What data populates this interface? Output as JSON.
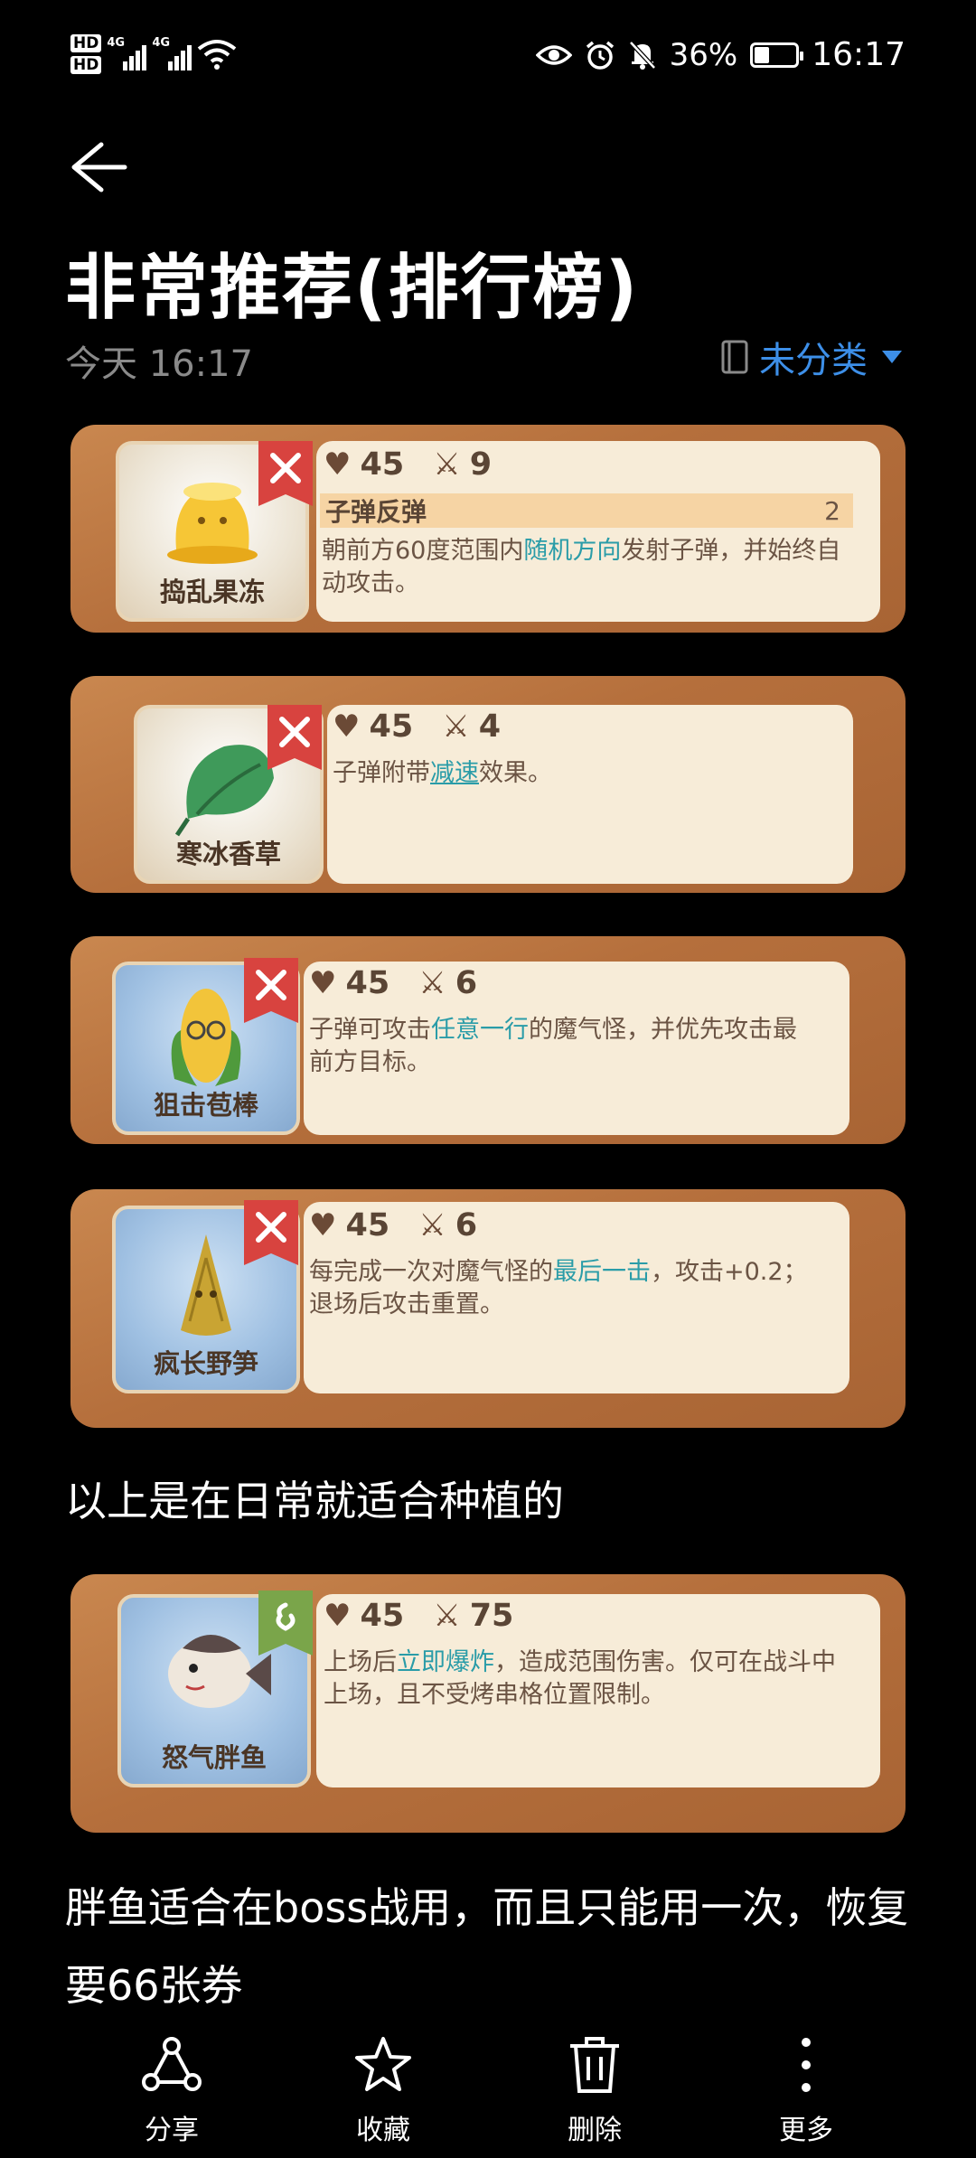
{
  "status": {
    "hd1": "HD",
    "hd2": "HD",
    "sim1": "4G",
    "sim2": "4G",
    "battery_pct": "36%",
    "battery_level": 0.36,
    "time": "16:17"
  },
  "note": {
    "title": "非常推荐(排行榜)",
    "date": "今天 16:17",
    "category": "未分类"
  },
  "cards": [
    {
      "name": "捣乱果冻",
      "hp": "45",
      "atk": "9",
      "badge": "attack",
      "tag": "子弹反弹",
      "tag_level": "2",
      "desc_a": "朝前方60度范围内",
      "desc_hl": "随机方向",
      "desc_b": "发射子弹，并始终自动攻击。"
    },
    {
      "name": "寒冰香草",
      "hp": "45",
      "atk": "4",
      "badge": "attack",
      "desc_a": "子弹附带",
      "desc_hl": "减速",
      "desc_b": "效果。"
    },
    {
      "name": "狙击苞棒",
      "hp": "45",
      "atk": "6",
      "badge": "attack",
      "desc_a": "子弹可攻击",
      "desc_hl": "任意一行",
      "desc_b": "的魔气怪，并优先攻击最前方目标。"
    },
    {
      "name": "疯长野笋",
      "hp": "45",
      "atk": "6",
      "badge": "attack",
      "desc_a": "每完成一次对魔气怪的",
      "desc_hl": "最后一击",
      "desc_b": "，攻击+0.2；退场后攻击重置。"
    },
    {
      "name": "怒气胖鱼",
      "hp": "45",
      "atk": "75",
      "badge": "summon",
      "desc_a": "上场后",
      "desc_hl": "立即爆炸",
      "desc_b": "，造成范围伤害。仅可在战斗中上场，且不受烤串格位置限制。"
    }
  ],
  "paragraph1": "以上是在日常就适合种植的",
  "paragraph2": "胖鱼适合在boss战用，而且只能用一次，恢复要66张券",
  "toolbar": {
    "share": "分享",
    "favorite": "收藏",
    "delete": "删除",
    "more": "更多"
  }
}
